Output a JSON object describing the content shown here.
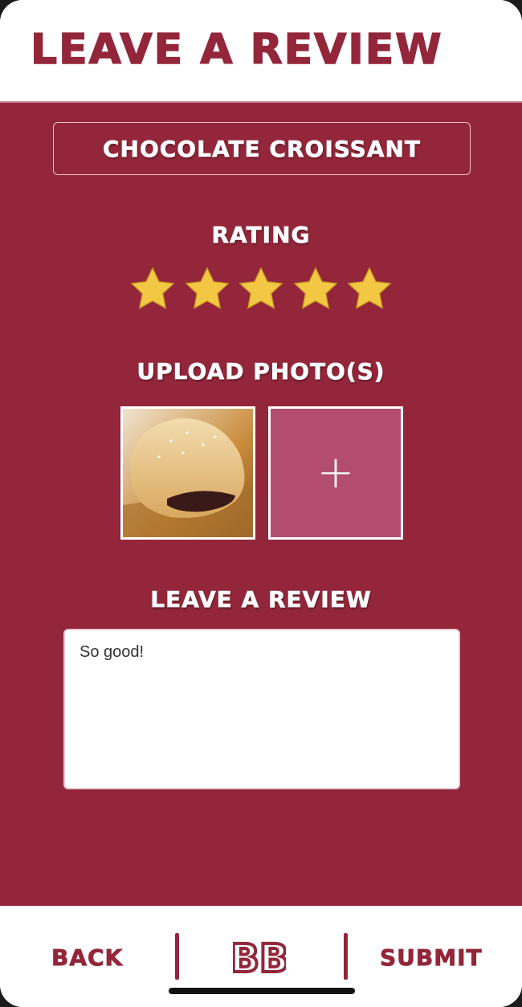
{
  "header": {
    "title": "LEAVE A REVIEW"
  },
  "product": {
    "name": "CHOCOLATE CROISSANT"
  },
  "rating": {
    "label": "RATING",
    "value": 5,
    "max": 5,
    "star_color": "#f2c744"
  },
  "photos": {
    "label": "UPLOAD PHOTO(S)",
    "add_symbol": "+"
  },
  "review": {
    "label": "LEAVE A REVIEW",
    "text": "So good!"
  },
  "footer": {
    "back_label": "BACK",
    "logo_text": "BB",
    "submit_label": "SUBMIT"
  },
  "colors": {
    "primary": "#93263a",
    "accent": "#b24d70",
    "background": "#ffffff"
  },
  "icons": {
    "star": "star-icon",
    "add": "plus-icon",
    "logo": "bb-logo"
  }
}
